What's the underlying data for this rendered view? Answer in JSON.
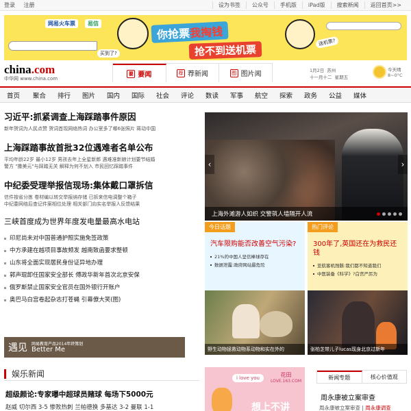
{
  "topbar": {
    "login": "登录",
    "register": "注册",
    "links": [
      "设为书签",
      "公众号",
      "手机版",
      "iPad版",
      "搜索新闻",
      "返回首页>>"
    ]
  },
  "banner": {
    "brand1": "网易火车票",
    "brand2": "易信",
    "bubble1": "买到了?",
    "slogan1_a": "你抢票",
    "slogan1_b": "我掏钱",
    "slogan2": "抢不到送机票",
    "bubble2": "送机票?"
  },
  "header": {
    "brand_name": "china",
    "brand_dot": ".",
    "brand_tld": "com",
    "brand_sub": "中华网 www.china.com",
    "tabs": [
      {
        "icon": "要",
        "label": "要闻"
      },
      {
        "icon": "荐",
        "label": "荐新闻"
      },
      {
        "icon": "图",
        "label": "图片闻"
      }
    ],
    "date": "1月2日",
    "lunar": "十一月十二",
    "city": "苏州",
    "weekday": "星期五",
    "weather_label": "今天晴",
    "temp": "8~0°C",
    "weather_icon": "sun-icon"
  },
  "nav": [
    "首页",
    "聚合",
    "排行",
    "图片",
    "国内",
    "国际",
    "社会",
    "评论",
    "数读",
    "军事",
    "航空",
    "探索",
    "政务",
    "公益",
    "媒体"
  ],
  "lead": [
    {
      "title": "习近平:抓紧调查上海踩踏事件原因",
      "sub": "新年贺词为人民点赞 贺词首现网络热词 办公室多了哪6张照片 蒋动中国"
    },
    {
      "title": "上海踩踏事故首批32位遇难者名单公布",
      "sub1": "平均年龄22岁 最小12岁 男孩去年上全星新郎 遇难准新娘计划要节结婚",
      "sub2": "警方 \"撒美元\"与踩踏无关 解释为何不划入 市民回忆踩踏事件"
    },
    {
      "title": "中纪委受理举报信现场:集体戴口罩拆信",
      "sub1": "信件按省分拣 卷材编以转交举报纳存储 已拆来信电调整个箱子",
      "sub2": "中纪委网络后查记件案相位处理 相关部门向实名举报人反馈结果"
    }
  ],
  "plain_head": "三峡首度成为世界年度发电量最高水电站",
  "news_list": [
    "印尼尚未对中国普通护照实施免签政策",
    "中方承建在越项目事故频发 越南致函要求整顿",
    "山东将全面实现居民身份证异地办理",
    "郭声琨卸任国家安全部长 傅政华新年首次北京安保",
    "俄罗斯禁止国家安全官员在国外银行开账户",
    "奥巴马白宫卷起杂志打苍蝇 引幕僚大笑(图)"
  ],
  "ad_better": {
    "big": "遇见",
    "small": "网易教育产品2014年终策划",
    "en": "Better Me"
  },
  "ent_section": {
    "title": "娱乐新闻",
    "headline": "超级颜论:专家曝中超球员赌球 每场下5000元",
    "sub": "赵威 切尔西 3-5 惨败热刺 兰帕德换 多基达 3-2 曼联 1-1"
  },
  "photo": {
    "caption": "上海外滩游人如织 交警筑人墙隔开人流",
    "dots": 5,
    "active_dot": 0
  },
  "topics": [
    {
      "label": "今日话题",
      "question": "汽车限购能否改善空气污染?",
      "items": [
        "21%的中国人坚信棒球存在",
        "数据泄露:政府网站最危险"
      ]
    },
    {
      "label": "热门评论",
      "question": "300年了,英国还在为救民还钱",
      "items": [
        "亚航客机残骸:我们都不知道我们",
        "中医装备《科学》?白宫严厉为"
      ]
    }
  ],
  "thumbs": [
    "野生动物拯救动物系动物和实在外的",
    "张柏芝带儿子lucas现身北京过新年"
  ],
  "ad_love": {
    "love": "i love you",
    "brand": "花田",
    "site": "LOVE.163.COM",
    "slogan": "想上不讲"
  },
  "right_tabs": [
    "新闻专题",
    "核心价值观"
  ],
  "right_news": {
    "title": "周永康被立案审查",
    "sub_a": "周永康被立案审查",
    "sub_b": "周永康调查"
  },
  "colors": {
    "accent": "#cc0000",
    "banner_bg": "#fde55a",
    "topic_a_bg": "#e8f6ff",
    "topic_b_bg": "#fdf1b9"
  }
}
